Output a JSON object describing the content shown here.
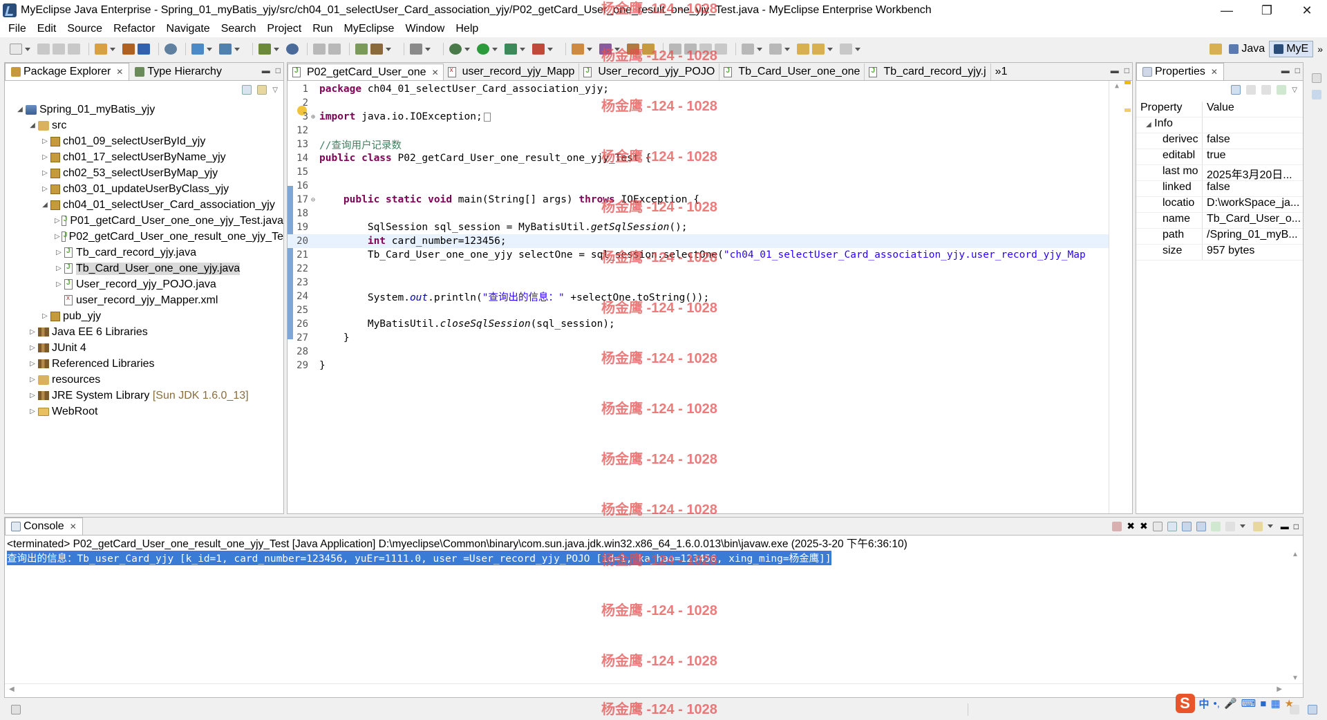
{
  "window": {
    "title": "MyEclipse Java Enterprise - Spring_01_myBatis_yjy/src/ch04_01_selectUser_Card_association_yjy/P02_getCard_User_one_result_one_yjy_Test.java - MyEclipse Enterprise Workbench"
  },
  "menu": [
    "File",
    "Edit",
    "Source",
    "Refactor",
    "Navigate",
    "Search",
    "Project",
    "Run",
    "MyEclipse",
    "Window",
    "Help"
  ],
  "perspectives": {
    "java": "Java",
    "myeclipse": "MyE"
  },
  "explorer": {
    "tabs": {
      "package_explorer": "Package Explorer",
      "type_hierarchy": "Type Hierarchy"
    },
    "tree": {
      "project": "Spring_01_myBatis_yjy",
      "src": "src",
      "packages": [
        "ch01_09_selectUserById_yjy",
        "ch01_17_selectUserByName_yjy",
        "ch02_53_selectUserByMap_yjy",
        "ch03_01_updateUserByClass_yjy",
        "ch04_01_selectUser_Card_association_yjy"
      ],
      "files": [
        "P01_getCard_User_one_one_yjy_Test.java",
        "P02_getCard_User_one_result_one_yjy_Te",
        "Tb_card_record_yjy.java",
        "Tb_Card_User_one_one_yjy.java",
        "User_record_yjy_POJO.java",
        "user_record_yjy_Mapper.xml"
      ],
      "pub_pkg": "pub_yjy",
      "libraries": [
        "Java EE 6 Libraries",
        "JUnit 4",
        "Referenced Libraries"
      ],
      "resources": "resources",
      "jre": "JRE System Library",
      "jre_version": "[Sun JDK 1.6.0_13]",
      "webroot": "WebRoot"
    }
  },
  "editor": {
    "tabs": [
      "P02_getCard_User_one",
      "user_record_yjy_Mapp",
      "User_record_yjy_POJO",
      "Tb_Card_User_one_one",
      "Tb_card_record_yjy.j"
    ],
    "overflow": "»1",
    "lines": {
      "l1": "1",
      "l2": "2",
      "l3": "3",
      "l12": "12",
      "l13": "13",
      "l14": "14",
      "l15": "15",
      "l16": "16",
      "l17": "17",
      "l18": "18",
      "l19": "19",
      "l20": "20",
      "l21": "21",
      "l22": "22",
      "l23": "23",
      "l24": "24",
      "l25": "25",
      "l26": "26",
      "l27": "27",
      "l28": "28",
      "l29": "29"
    },
    "code": {
      "pkg_kw": "package",
      "pkg_name": " ch04_01_selectUser_Card_association_yjy;",
      "import_kw": "import",
      "import_name": " java.io.IOException;",
      "comment": "//查询用户记录数",
      "class_kw": "public class",
      "class_name": " P02_getCard_User_one_result_one_yjy_Test {",
      "main_kw1": "public static void",
      "main_sig": " main(String[] args) ",
      "main_kw2": "throws",
      "main_exc": " IOException {",
      "l19_a": "SqlSession sql_session = MyBatisUtil.",
      "l19_b": "getSqlSession",
      "l19_c": "();",
      "l20_kw": "int",
      "l20_rest": " card_number=123456;",
      "l21_a": "Tb_Card_User_one_one_yjy selectOne = sql_session.selectOne(",
      "l21_str": "\"ch04_01_selectUser_Card_association_yjy.user_record_yjy_Map",
      "l24_a": "System.",
      "l24_out": "out",
      "l24_b": ".println(",
      "l24_str": "\"查询出的信息：\"",
      "l24_c": " +selectOne.toString());",
      "l26_a": "MyBatisUtil.",
      "l26_b": "closeSqlSession",
      "l26_c": "(sql_session);",
      "close_brace": "}"
    }
  },
  "properties": {
    "tab": "Properties",
    "headers": {
      "property": "Property",
      "value": "Value"
    },
    "group": "Info",
    "rows": [
      {
        "key": "derivec",
        "value": "false"
      },
      {
        "key": "editabl",
        "value": "true"
      },
      {
        "key": "last mo",
        "value": "2025年3月20日..."
      },
      {
        "key": "linked",
        "value": "false"
      },
      {
        "key": "locatio",
        "value": "D:\\workSpace_ja..."
      },
      {
        "key": "name",
        "value": "Tb_Card_User_o..."
      },
      {
        "key": "path",
        "value": "/Spring_01_myB..."
      },
      {
        "key": "size",
        "value": "957  bytes"
      }
    ]
  },
  "console": {
    "tab": "Console",
    "header": "<terminated> P02_getCard_User_one_result_one_yjy_Test [Java Application] D:\\myeclipse\\Common\\binary\\com.sun.java.jdk.win32.x86_64_1.6.0.013\\bin\\javaw.exe (2025-3-20 下午6:36:10)",
    "output": "查询出的信息：Tb_user_Card_yjy [k_id=1, card_number=123456, yuEr=1111.0, user =User_record_yjy_POJO [id=1, ka_hao=123456, xing_ming=杨金鹰]]"
  },
  "watermark": "杨金鹰 -124 - 1028",
  "ime": {
    "logo": "S",
    "lang": "中"
  },
  "colors": {
    "keyword": "#7f0055",
    "comment": "#3f7f5f",
    "string": "#2a00ff",
    "selection": "#3a7bd5",
    "watermark": "#e65050"
  }
}
